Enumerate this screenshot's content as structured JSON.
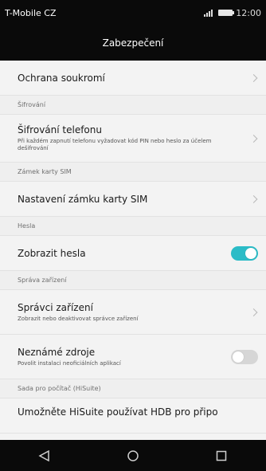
{
  "status_bar": {
    "carrier": "T-Mobile CZ",
    "time": "12:00",
    "signal_icon": "signal-icon",
    "battery_icon": "battery-icon"
  },
  "header": {
    "title": "Zabezpečení"
  },
  "settings": {
    "privacy": {
      "title": "Ochrana soukromí"
    },
    "encryption_section": "Šifrování",
    "encryption": {
      "title": "Šifrování telefonu",
      "subtitle": "Při každém zapnutí telefonu vyžadovat kód PIN nebo heslo za účelem dešifrování"
    },
    "sim_lock_section": "Zámek karty SIM",
    "sim_lock": {
      "title": "Nastavení zámku karty SIM"
    },
    "passwords_section": "Hesla",
    "show_passwords": {
      "title": "Zobrazit hesla",
      "enabled": true
    },
    "device_admin_section": "Správa zařízení",
    "device_admins": {
      "title": "Správci zařízení",
      "subtitle": "Zobrazit nebo deaktivovat správce zařízení"
    },
    "unknown_sources": {
      "title": "Neznámé zdroje",
      "subtitle": "Povolit instalaci neoficiálních aplikací",
      "enabled": false
    },
    "hisuite_section": "Sada pro počítač (HiSuite)",
    "hisuite_partial": {
      "title": "Umožněte HiSuite používat HDB pro připo"
    }
  },
  "nav_bar": {
    "back_icon": "back-triangle-icon",
    "home_icon": "home-circle-icon",
    "recents_icon": "recents-square-icon"
  },
  "colors": {
    "toggle_on": "#2bbcc7",
    "toggle_off": "#d6d6d6",
    "bar_background": "#0a0a0a",
    "content_background": "#f3f3f3"
  }
}
